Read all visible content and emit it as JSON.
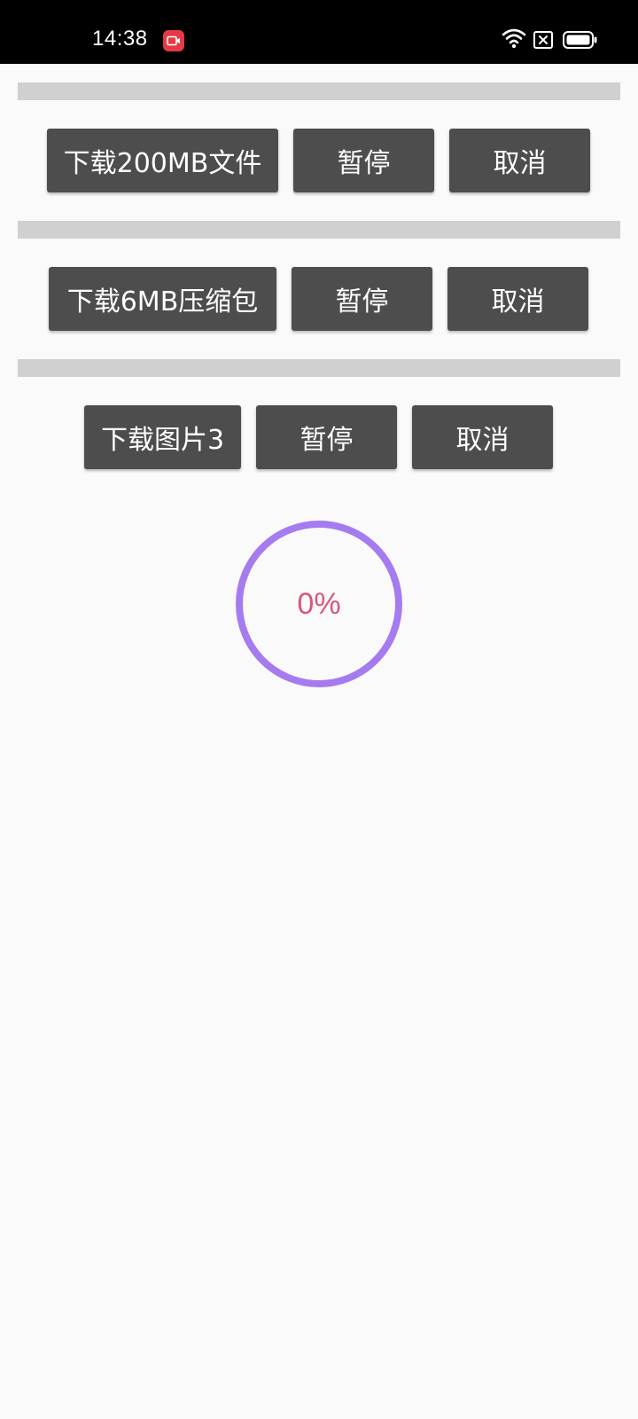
{
  "status_bar": {
    "time": "14:38",
    "icons": [
      "screen-record-icon",
      "wifi-icon",
      "sim-x-icon",
      "battery-icon"
    ]
  },
  "download_rows": [
    {
      "progress_percent": 0,
      "download_label": "下载200MB文件",
      "pause_label": "暂停",
      "cancel_label": "取消"
    },
    {
      "progress_percent": 0,
      "download_label": "下载6MB压缩包",
      "pause_label": "暂停",
      "cancel_label": "取消"
    },
    {
      "progress_percent": 0,
      "download_label": "下载图片3",
      "pause_label": "暂停",
      "cancel_label": "取消"
    }
  ],
  "circular_progress": {
    "value_percent": 0,
    "label": "0%",
    "ring_color": "#a67bf0",
    "text_color": "#d9577a"
  },
  "colors": {
    "button_bg": "#4d4d4d",
    "track_bg": "#d0d0d0",
    "page_bg": "#fafafa"
  }
}
